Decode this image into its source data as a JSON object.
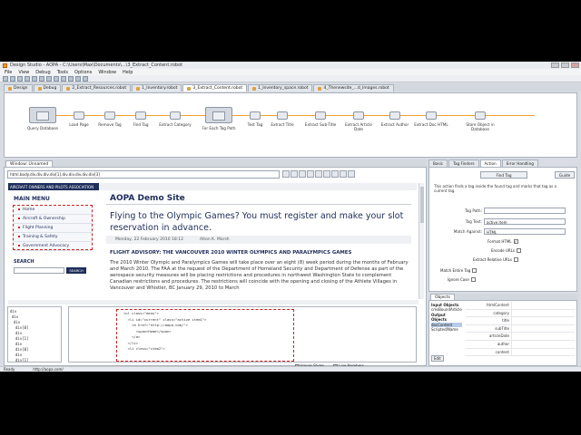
{
  "window": {
    "title": "Design Studio - AOPA - C:\\Users\\Max\\Documents\\...\\3_Extract_Content.robot"
  },
  "menu": [
    "File",
    "View",
    "Debug",
    "Tools",
    "Options",
    "Window",
    "Help"
  ],
  "mode_tabs": [
    "Design",
    "Debug"
  ],
  "file_tabs": [
    "2_Extract_Resources.robot",
    "1_Inventory.robot",
    "3_Extract_Content.robot",
    "1_Inventory_space.robot",
    "4_Thenewsite_...d_Images.robot"
  ],
  "flow_steps": [
    {
      "label": "Query Database",
      "big": true
    },
    {
      "label": "Load Page"
    },
    {
      "label": "Remove Tag"
    },
    {
      "label": "Find Tag"
    },
    {
      "label": "Extract Category"
    },
    {
      "label": "For Each Tag Path",
      "big": true
    },
    {
      "label": "Test Tag"
    },
    {
      "label": "Extract Title"
    },
    {
      "label": "Extract Sub-Title"
    },
    {
      "label": "Extract Article Date"
    },
    {
      "label": "Extract Author"
    },
    {
      "label": "Extract Doc HTML"
    },
    {
      "label": "Store Object in Database"
    }
  ],
  "browser": {
    "tab_label": "Window: Unnamed",
    "url": "html.body.div.div.div.div[1].div.div.div.div.div[3]",
    "site": {
      "banner": "AIRCRAFT OWNERS AND PILOTS ASSOCIATION",
      "menu_title": "MAIN MENU",
      "menu_items": [
        "Home",
        "Aircraft & Ownership",
        "Flight Planning",
        "Training & Safety",
        "Government Advocacy"
      ],
      "search_title": "SEARCH",
      "search_button": "SEARCH",
      "site_title": "AOPA Demo Site",
      "article_title": "Flying to the Olympic Games? You must register and make your slot reservation in advance.",
      "date": "Monday, 22 February 2010 18:12",
      "author": "Alton K. Marsh",
      "flight_heading": "FLIGHT ADVISORY: THE VANCOUVER 2010 WINTER OLYMPICS AND PARALYMPICS GAMES",
      "body": "The 2010 Winter Olympic and Paralympics Games will take place over an eight (8) week period during the months of February and March 2010. The FAA at the request of the Department of Homeland Security and Department of Defense as part of the aerospace security measures will be placing restrictions and procedures in northwest Washington State to complement Canadian restrictions and procedures. The restrictions will coincide with the opening and closing of the Athlete Villages in Vancouver and Whistler, BC January 29, 2010 to March"
    },
    "dom_tree": [
      "div",
      "div",
      "div",
      "div[0]",
      "div",
      "div[1]",
      "div",
      "div[0]",
      "div",
      "div[1]",
      "div[2]"
    ],
    "source_lines": [
      "<ul class=\"menu\">",
      "  <li id=\"current\" class=\"active item1\">",
      "    <a href=\"http://aopa.com/\">",
      "      <span>Home</span>",
      "    </a>",
      "  </li>",
      "  <li class=\"item2\">"
    ],
    "ignore_styles": "Ignore Styles",
    "line_numbers": "Line Numbers"
  },
  "right_tabs": [
    "Basic",
    "Tag Finders",
    "Action",
    "Error Handling"
  ],
  "action": {
    "selected": "Find Tag",
    "guide": "Guide",
    "help": "This action finds a tag inside the found tag and marks that tag as a current tag.",
    "tag_path_label": "Tag Path:",
    "tag_path_value": "",
    "tag_text_label": "Tag Text:",
    "tag_text_value": "active item",
    "match_against_label": "Match Against:",
    "match_against_value": "HTML",
    "checkboxes": [
      {
        "label": "Format HTML",
        "checked": true
      },
      {
        "label": "Encode URLs",
        "checked": false
      },
      {
        "label": "Extract Relative URLs",
        "checked": false
      },
      {
        "label": "Match Entire Tag",
        "checked": false
      },
      {
        "label": "Ignore Case",
        "checked": false
      }
    ]
  },
  "objects_tab": "Objects",
  "objects": {
    "list": [
      "Input Objects",
      "cmsBoundArticle",
      "Output Objects",
      "docContent",
      "Scripted/Name"
    ],
    "bottom_button": "Edit",
    "fields": [
      "htmlContent",
      "category",
      "title",
      "subTitle",
      "articleDate",
      "author",
      "content"
    ]
  },
  "status": {
    "left": "Ready",
    "url": "http://aopa.com/"
  },
  "colors": {
    "accent": "#f0a030",
    "banner": "#1e2d5a",
    "highlight": "#d02020"
  }
}
